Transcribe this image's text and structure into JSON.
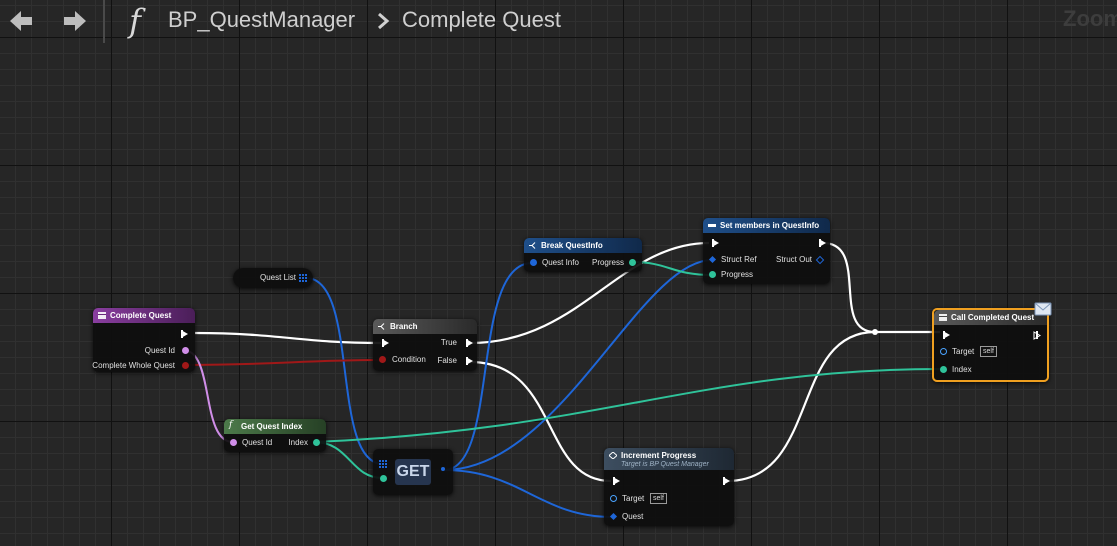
{
  "toolbar": {
    "back_icon": "arrow-left-icon",
    "forward_icon": "arrow-right-icon",
    "function_icon": "function-icon",
    "breadcrumb_blueprint": "BP_QuestManager",
    "breadcrumb_function": "Complete Quest",
    "zoom_label": "Zoom"
  },
  "colors": {
    "exec_wire": "#ffffff",
    "struct_wire": "#1e66d8",
    "int_wire": "#2fc39a",
    "bool_wire": "#a01818",
    "string_wire": "#d08ee8",
    "selected_outline": "#f0a020"
  },
  "nodes": {
    "complete_quest": {
      "title": "Complete Quest",
      "pins": {
        "quest_id": "Quest Id",
        "complete_whole_quest": "Complete Whole Quest"
      }
    },
    "branch": {
      "title": "Branch",
      "pins": {
        "condition": "Condition",
        "true": "True",
        "false": "False"
      }
    },
    "get_quest_index": {
      "title": "Get Quest Index",
      "pins": {
        "quest_id": "Quest Id",
        "index": "Index"
      }
    },
    "quest_list": {
      "title": "Quest List"
    },
    "get_array": {
      "title": "GET"
    },
    "break_questinfo": {
      "title": "Break QuestInfo",
      "pins": {
        "quest_info": "Quest Info",
        "progress": "Progress"
      }
    },
    "set_members": {
      "title": "Set members in QuestInfo",
      "pins": {
        "struct_ref": "Struct Ref",
        "struct_out": "Struct Out",
        "progress": "Progress"
      }
    },
    "call_completed_quest": {
      "title": "Call Completed Quest",
      "pins": {
        "target": "Target",
        "target_default": "self",
        "index": "Index"
      }
    },
    "increment_progress": {
      "title": "Increment Progress",
      "subtitle": "Target is BP Quest Manager",
      "pins": {
        "target": "Target",
        "target_default": "self",
        "quest": "Quest"
      }
    }
  }
}
